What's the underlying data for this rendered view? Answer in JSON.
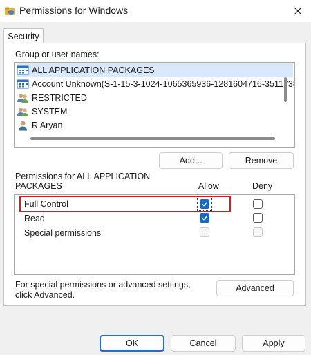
{
  "window": {
    "title": "Permissions for Windows",
    "icon": "folder-shield-icon",
    "close_icon": "close-icon"
  },
  "tab": {
    "label": "Security"
  },
  "users": {
    "heading": "Group or user names:",
    "items": [
      {
        "name": "ALL APPLICATION PACKAGES",
        "icon": "app-packages-icon"
      },
      {
        "name": "Account Unknown(S-1-15-3-1024-1065365936-1281604716-3511738",
        "icon": "app-packages-icon"
      },
      {
        "name": "RESTRICTED",
        "icon": "group-users-icon"
      },
      {
        "name": "SYSTEM",
        "icon": "group-users-icon"
      },
      {
        "name": "R Aryan",
        "icon": "user-icon"
      }
    ],
    "add_label": "Add...",
    "remove_label": "Remove"
  },
  "permissions": {
    "heading_line1": "Permissions for ALL APPLICATION",
    "heading_line2": "PACKAGES",
    "allow_label": "Allow",
    "deny_label": "Deny",
    "rows": [
      {
        "label": "Full Control",
        "allow": true,
        "deny": false,
        "enabled": true
      },
      {
        "label": "Read",
        "allow": true,
        "deny": false,
        "enabled": true
      },
      {
        "label": "Special permissions",
        "allow": false,
        "deny": false,
        "enabled": false
      }
    ]
  },
  "advanced": {
    "text_line1": "For special permissions or advanced settings,",
    "text_line2": "click Advanced.",
    "button_label": "Advanced"
  },
  "footer": {
    "ok_label": "OK",
    "cancel_label": "Cancel",
    "apply_label": "Apply"
  },
  "colors": {
    "accent": "#1469c8",
    "highlight": "#d01c1c"
  }
}
